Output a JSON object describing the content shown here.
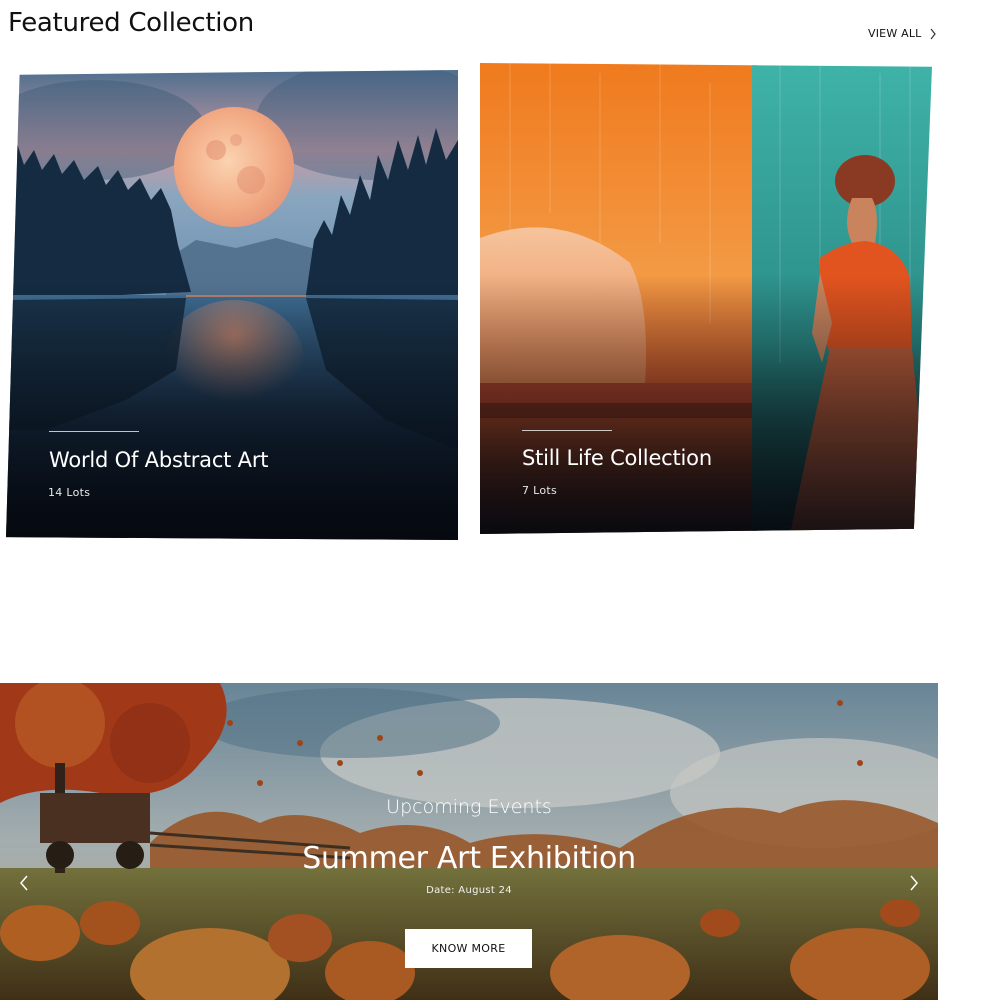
{
  "featured": {
    "title": "Featured Collection",
    "view_all_label": "VIEW ALL"
  },
  "collections": [
    {
      "title": "World Of Abstract Art",
      "lots": "14 Lots"
    },
    {
      "title": "Still Life Collection",
      "lots": "7 Lots"
    }
  ],
  "banner": {
    "eyebrow": "Upcoming Events",
    "title": "Summer Art Exhibition",
    "date": "Date: August 24",
    "cta_label": "KNOW MORE"
  },
  "colors": {
    "text_dark": "#111111",
    "white": "#ffffff"
  },
  "icons": {
    "view_all": "chevron-right-icon",
    "prev": "chevron-left-icon",
    "next": "chevron-right-icon"
  }
}
